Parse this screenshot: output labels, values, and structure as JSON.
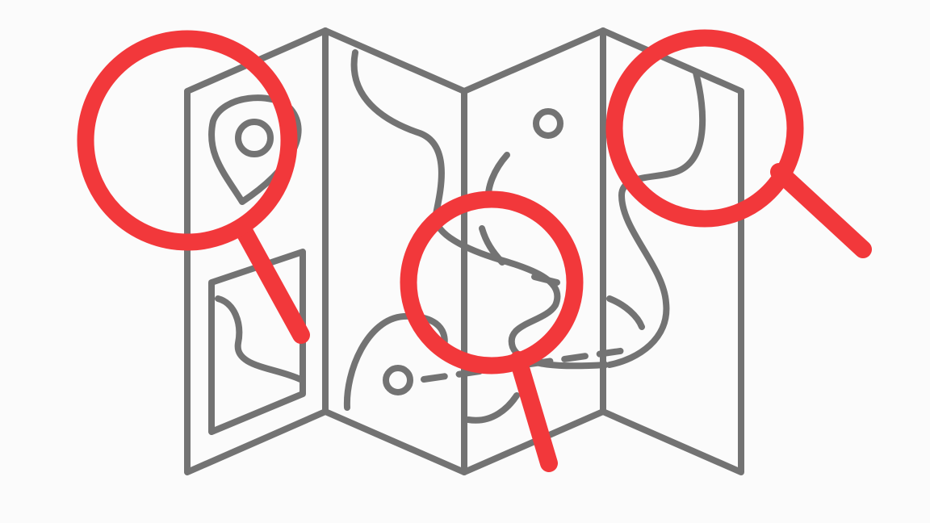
{
  "illustration": {
    "subject": "folded-map-with-magnifying-glasses",
    "colors": {
      "background": "#fbfbfb",
      "map_outline": "#737373",
      "magnifier": "#f2383b"
    },
    "icons": [
      "folded-map-icon",
      "magnifying-glass-icon"
    ],
    "magnifier_count": 3
  }
}
